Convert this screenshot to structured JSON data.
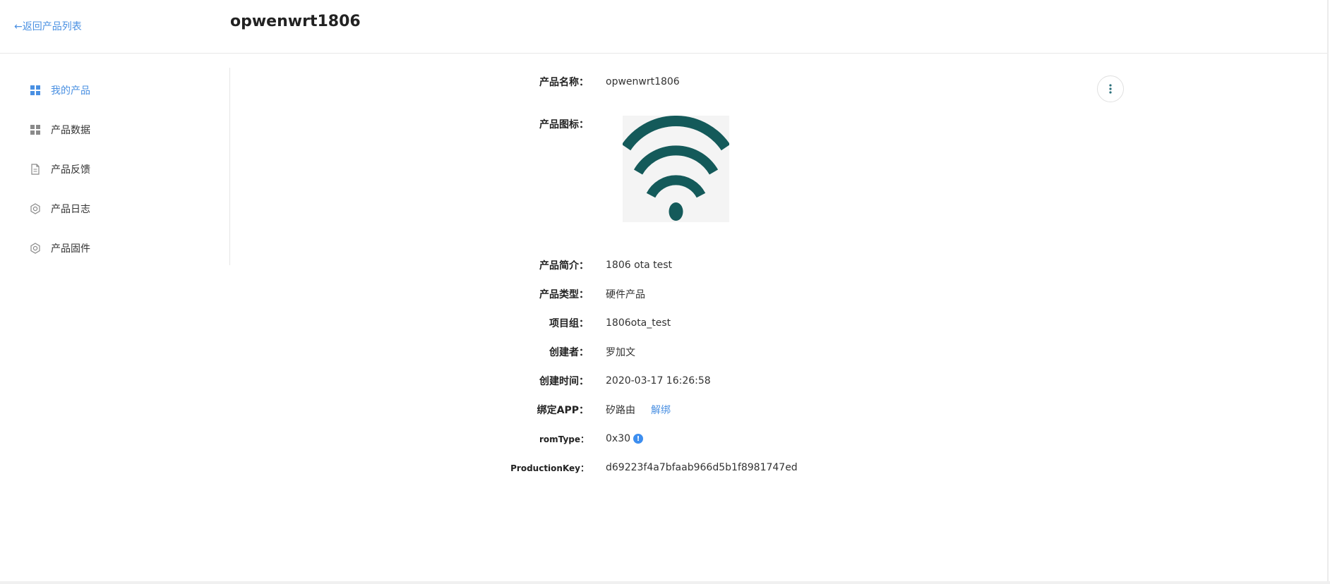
{
  "header": {
    "back_label": "←返回产品列表",
    "title": "opwenwrt1806"
  },
  "sidebar": {
    "items": [
      {
        "label": "我的产品",
        "icon": "grid-icon",
        "active": true
      },
      {
        "label": "产品数据",
        "icon": "grid-icon",
        "active": false
      },
      {
        "label": "产品反馈",
        "icon": "document-icon",
        "active": false
      },
      {
        "label": "产品日志",
        "icon": "gear-icon",
        "active": false
      },
      {
        "label": "产品固件",
        "icon": "gear-icon",
        "active": false
      }
    ]
  },
  "details": {
    "name": {
      "label": "产品名称：",
      "value": "opwenwrt1806"
    },
    "icon": {
      "label": "产品图标：",
      "icon": "wifi-icon"
    },
    "description": {
      "label": "产品简介：",
      "value": "1806 ota test"
    },
    "type": {
      "label": "产品类型：",
      "value": "硬件产品"
    },
    "project_group": {
      "label": "项目组：",
      "value": "1806ota_test"
    },
    "creator": {
      "label": "创建者：",
      "value": "罗加文"
    },
    "created_time": {
      "label": "创建时间：",
      "value": "2020-03-17 16:26:58"
    },
    "bound_app": {
      "label": "绑定APP：",
      "value": "矽路由",
      "unbind_label": "解绑"
    },
    "rom_type": {
      "label": "romType：",
      "value": "0x30",
      "info_icon": "!"
    },
    "production_key": {
      "label": "ProductionKey：",
      "value": "d69223f4a7bfaab966d5b1f8981747ed"
    }
  },
  "colors": {
    "accent": "#4a90e2",
    "icon_teal": "#145a5a",
    "info_blue": "#3d8eef"
  }
}
